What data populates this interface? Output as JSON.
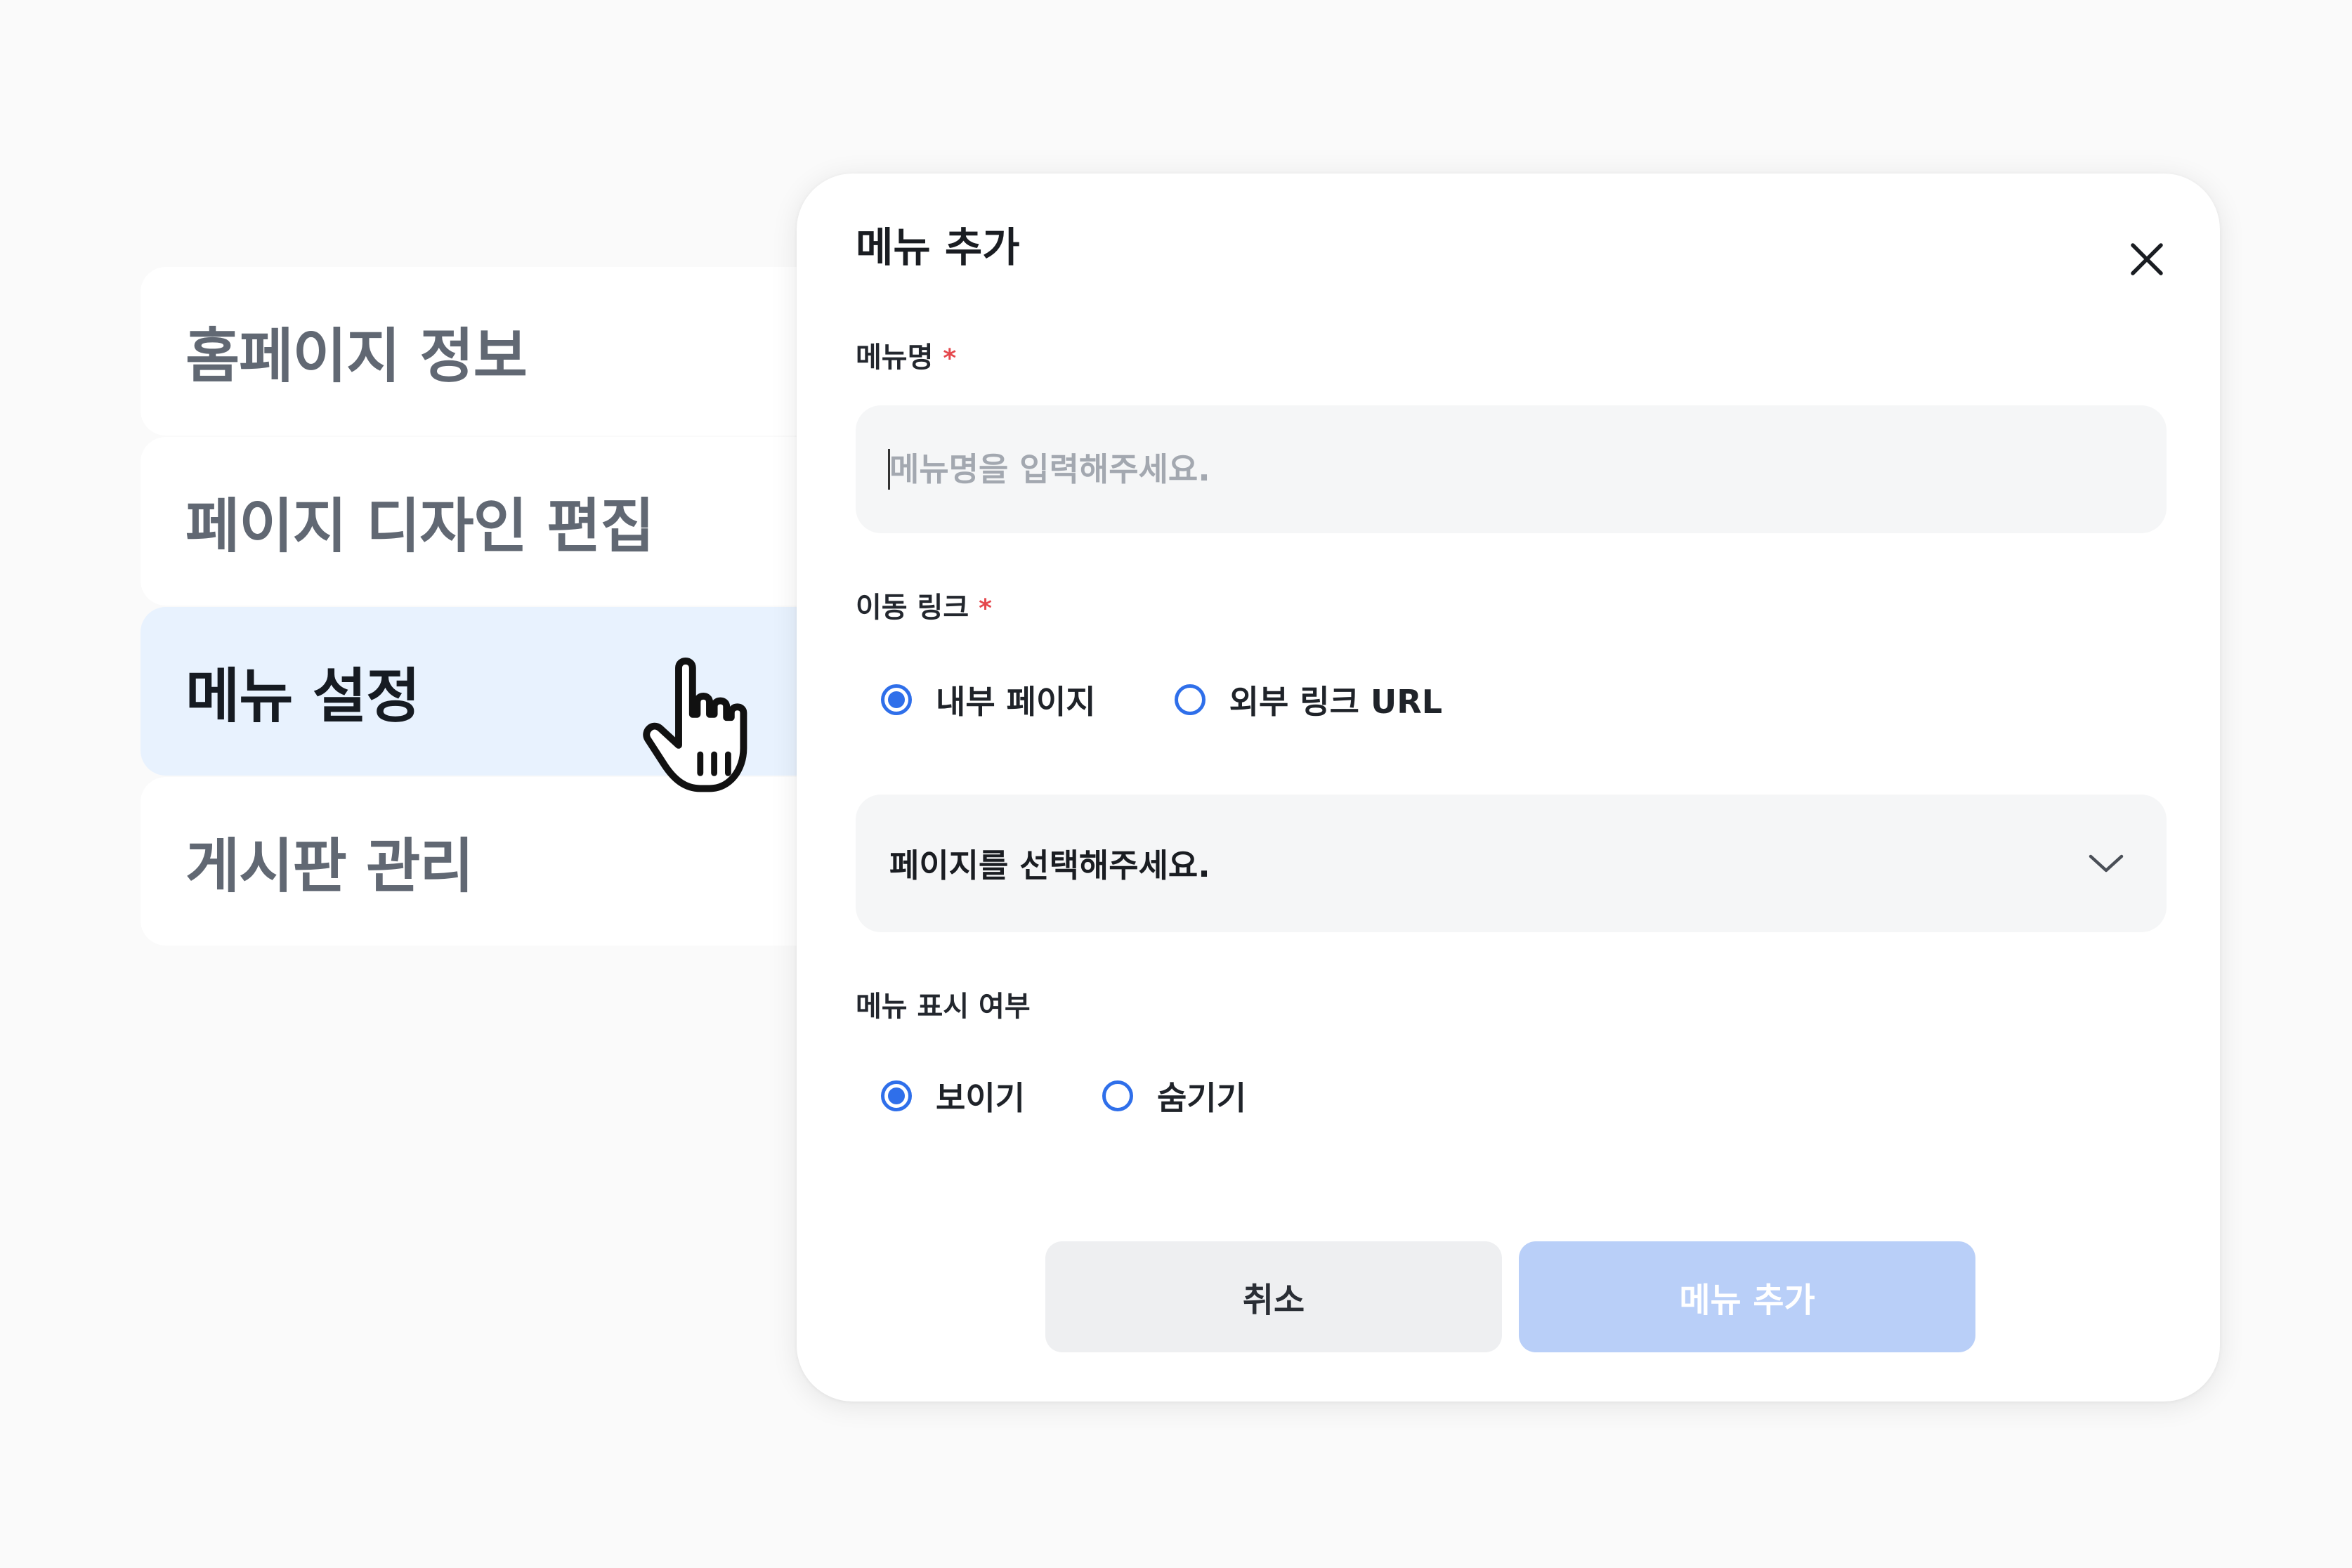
{
  "sidebar": {
    "items": [
      {
        "label": "홈페이지 정보"
      },
      {
        "label": "페이지 디자인 편집"
      },
      {
        "label": "메뉴 설정"
      },
      {
        "label": "게시판 관리"
      }
    ],
    "active_index": 2
  },
  "modal": {
    "title": "메뉴 추가",
    "menu_name": {
      "label": "메뉴명",
      "required_mark": "*",
      "placeholder": "메뉴명을 입력해주세요.",
      "value": ""
    },
    "link": {
      "label": "이동 링크",
      "required_mark": "*",
      "options": [
        {
          "label": "내부 페이지",
          "checked": true
        },
        {
          "label": "외부 링크 URL",
          "checked": false
        }
      ],
      "select": {
        "value": "페이지를 선택해주세요."
      }
    },
    "visibility": {
      "label": "메뉴 표시 여부",
      "options": [
        {
          "label": "보이기",
          "checked": true
        },
        {
          "label": "숨기기",
          "checked": false
        }
      ]
    },
    "buttons": {
      "cancel": "취소",
      "submit": "메뉴 추가"
    }
  },
  "colors": {
    "accent": "#2f6fea",
    "submit_disabled": "#b9cff8",
    "required": "#e5484d",
    "active_item_bg": "#e8f2fe"
  },
  "icons": {
    "close": "close-icon",
    "dropdown": "chevron-down-icon",
    "cursor": "hand-pointer-icon"
  }
}
